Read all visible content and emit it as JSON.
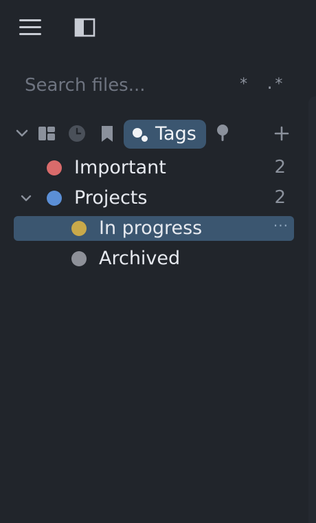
{
  "search": {
    "placeholder": "Search files...",
    "glob_label": "*",
    "regex_label": ".*"
  },
  "toolbar": {
    "active_tab_label": "Tags"
  },
  "tags": [
    {
      "label": "Important",
      "count": "2",
      "color": "#d96b6b"
    },
    {
      "label": "Projects",
      "count": "2",
      "color": "#5b8fd6"
    },
    {
      "label": "In progress",
      "color": "#c9a94a",
      "more": "···"
    },
    {
      "label": "Archived",
      "color": "#8e9199"
    }
  ],
  "colors": {
    "background": "#21252b",
    "selection": "#3b5670",
    "muted_text": "#8b919c"
  },
  "icons": [
    "hamburger-menu-icon",
    "toggle-sidebar-icon",
    "collapse-chevron-icon",
    "layout-icon",
    "clock-icon",
    "bookmark-icon",
    "tags-icon",
    "pin-icon",
    "plus-icon"
  ]
}
